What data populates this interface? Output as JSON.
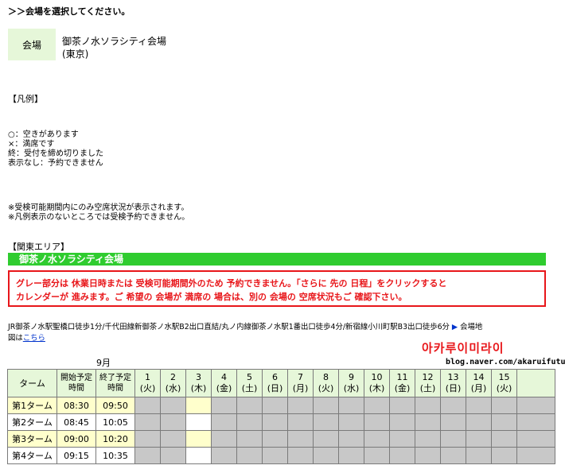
{
  "heading": "＞＞会場を選択してください。",
  "venue": {
    "label": "会場",
    "name": "御茶ノ水ソラシティ会場",
    "city": "(東京)"
  },
  "legend": {
    "title": "【凡例】",
    "items": [
      "○：空きがあります",
      "×：満席です",
      "終：受付を締め切りました",
      "表示なし：予約できません"
    ]
  },
  "notes": [
    "※受検可能期間内にのみ空席状況が表示されます。",
    "※凡例表示のないところでは受検予約できません。"
  ],
  "area_title": "【関東エリア】",
  "banner": "御茶ノ水ソラシティ会場",
  "notice": {
    "line1": "グレー部分は 休業日時または 受検可能期間外のため 予約できません。「さらに 先の 日程」をクリックすると",
    "line2": "カレンダーが 進みます。ご 希望の 会場が 満席の 場合は、別の 会場の 空席状況もご 確認下さい。"
  },
  "access": {
    "line1": "JR御茶ノ水駅聖橋口徒歩1分/千代田線新御茶ノ水駅B2出口直結/丸ノ内線御茶ノ水駅1番出口徒歩4分/新宿線小川町駅B3出口徒歩6分",
    "map_arrow": "▶",
    "map_label": "会場地",
    "line2_prefix": "図は",
    "line2_link": "こちら"
  },
  "watermark": {
    "title": "아카루이미라이",
    "url": "blog.naver.com/akaruifuture"
  },
  "calendar": {
    "month": "9月",
    "header_term": "ターム",
    "header_start": [
      "開始予定",
      "時間"
    ],
    "header_end": [
      "終了予定",
      "時間"
    ],
    "days": [
      {
        "d": "1",
        "w": "(火)"
      },
      {
        "d": "2",
        "w": "(水)"
      },
      {
        "d": "3",
        "w": "(木)"
      },
      {
        "d": "4",
        "w": "(金)"
      },
      {
        "d": "5",
        "w": "(土)"
      },
      {
        "d": "6",
        "w": "(日)"
      },
      {
        "d": "7",
        "w": "(月)"
      },
      {
        "d": "8",
        "w": "(火)"
      },
      {
        "d": "9",
        "w": "(水)"
      },
      {
        "d": "10",
        "w": "(木)"
      },
      {
        "d": "11",
        "w": "(金)"
      },
      {
        "d": "12",
        "w": "(土)"
      },
      {
        "d": "13",
        "w": "(日)"
      },
      {
        "d": "14",
        "w": "(月)"
      },
      {
        "d": "15",
        "w": "(火)"
      }
    ],
    "rows": [
      {
        "term": "第1ターム",
        "start": "08:30",
        "end": "09:50",
        "highlight": true
      },
      {
        "term": "第2ターム",
        "start": "08:45",
        "end": "10:05",
        "highlight": false
      },
      {
        "term": "第3ターム",
        "start": "09:00",
        "end": "10:20",
        "highlight": true
      },
      {
        "term": "第4ターム",
        "start": "09:15",
        "end": "10:35",
        "highlight": false
      }
    ]
  },
  "colors": {
    "green": "#2fcc2f",
    "red": "#e8161a",
    "gray": "#c8c8c8",
    "yellow": "#ffffcc",
    "light_green": "#e6f7d9"
  }
}
